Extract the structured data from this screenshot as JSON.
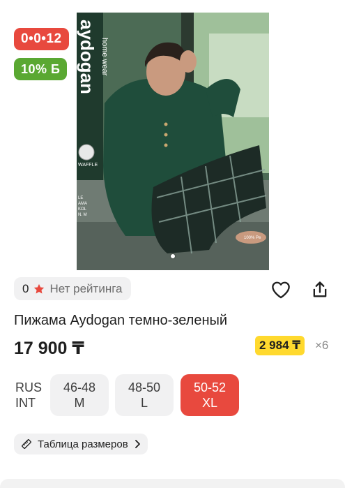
{
  "badges": {
    "timer": "0•0•12",
    "discount": "10% Б"
  },
  "image": {
    "brand_text": "aydogan",
    "brand_sub": "home wear",
    "fabric_tag": "WAFFLE",
    "label_lines": [
      "LE",
      "AMA",
      "KOL",
      "N. M"
    ],
    "badge_text": "100% Pe",
    "gallery_dot_count": 1
  },
  "rating": {
    "count": "0",
    "label": "Нет рейтинга"
  },
  "product": {
    "title": "Пижама Aydogan темно-зеленый",
    "price": "17 900 ₸",
    "installment_price": "2 984 ₸",
    "installment_multiplier": "×6"
  },
  "sizes": {
    "system_labels": [
      "RUS",
      "INT"
    ],
    "options": [
      {
        "rus": "46-48",
        "int": "M",
        "selected": false
      },
      {
        "rus": "48-50",
        "int": "L",
        "selected": false
      },
      {
        "rus": "50-52",
        "int": "XL",
        "selected": true
      }
    ]
  },
  "size_table": {
    "label": "Таблица размеров"
  },
  "colors": {
    "accent_red": "#e8493e",
    "discount_green": "#5aa832",
    "installment_yellow": "#ffd92e",
    "chip_gray": "#f1f1f2"
  },
  "icons": [
    "star-icon",
    "heart-icon",
    "share-icon",
    "ruler-icon",
    "chevron-right-icon"
  ]
}
